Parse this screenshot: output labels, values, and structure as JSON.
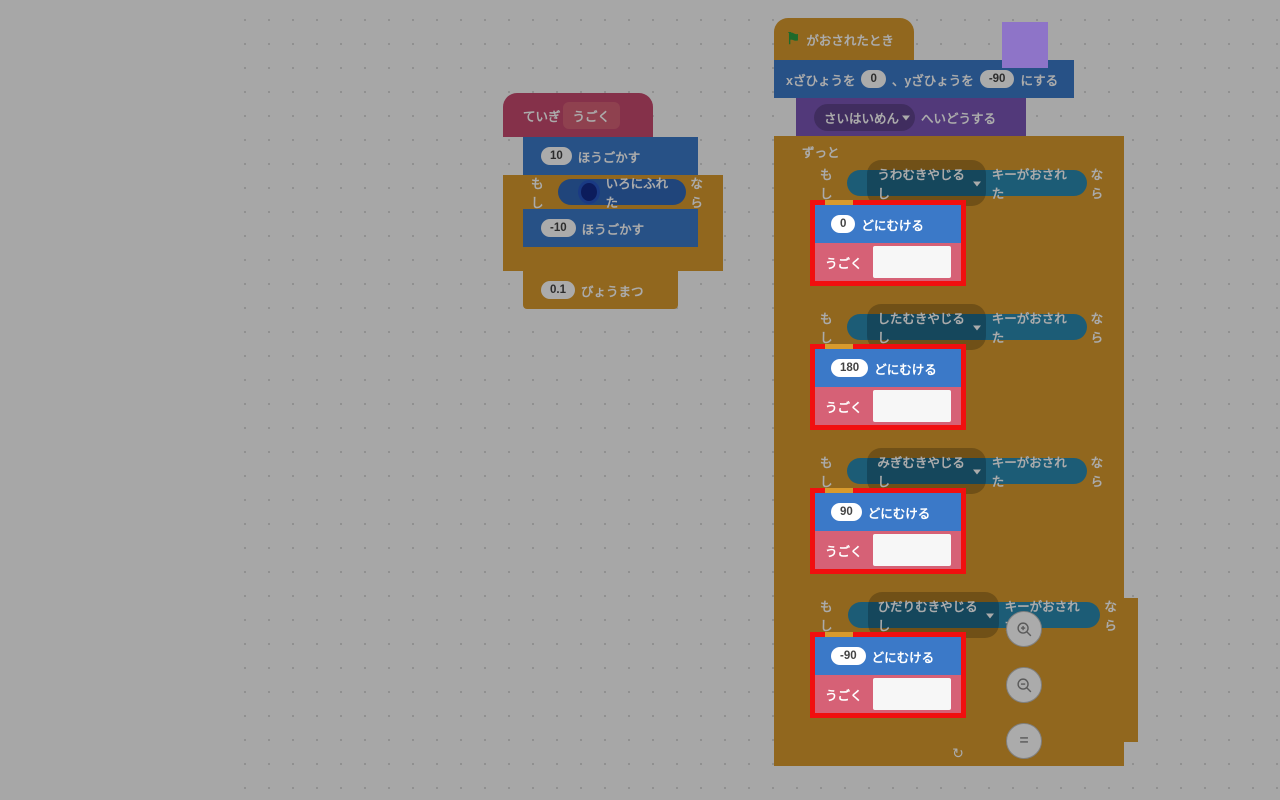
{
  "left": {
    "define": "ていぎ",
    "define_name": "うごく",
    "move_steps_value": "10",
    "move_steps_label": "ほうごかす",
    "if_label": "もし",
    "touching_color": "いろにふれた",
    "then_label": "なら",
    "neg_steps_value": "-10",
    "neg_steps_label": "ほうごかす",
    "wait_value": "0.1",
    "wait_label": "びょうまつ"
  },
  "right": {
    "when_flag": "がおされたとき",
    "goto_x_label": "xざひょうを",
    "goto_x": "0",
    "goto_y_label": "、yざひょうを",
    "goto_y": "-90",
    "goto_suffix": "にする",
    "layer_drop": "さいはいめん",
    "layer_suffix": "へいどうする",
    "forever": "ずっと",
    "if_label": "もし",
    "key_pressed": "キーがおされた",
    "then_label": "なら",
    "direction_label": "どにむける",
    "ugoku": "うごく",
    "keys": {
      "up": {
        "name": "うわむきやじるし",
        "deg": "0"
      },
      "down": {
        "name": "したむきやじるし",
        "deg": "180"
      },
      "right": {
        "name": "みぎむきやじるし",
        "deg": "90"
      },
      "left": {
        "name": "ひだりむきやじるし",
        "deg": "-90"
      }
    }
  },
  "zoom": {
    "in": "⊕",
    "out": "⊖",
    "eq": "="
  }
}
